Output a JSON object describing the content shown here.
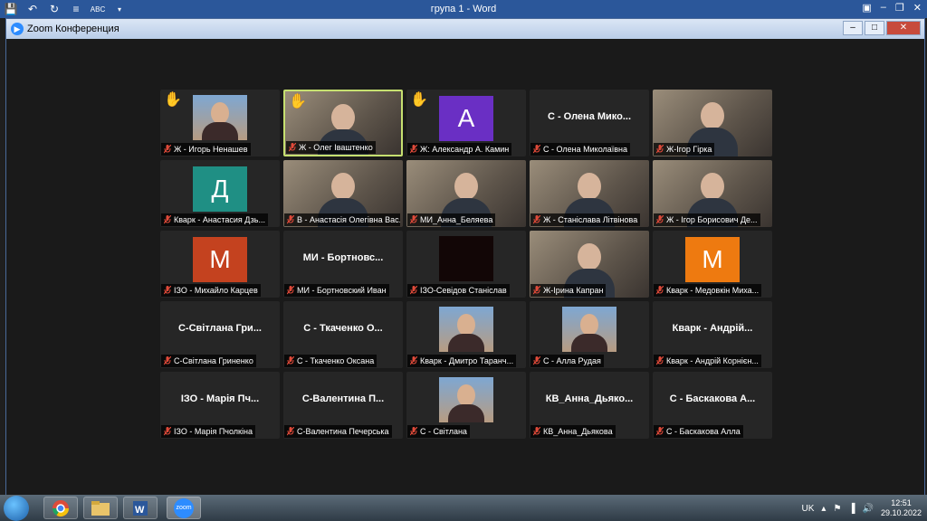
{
  "word_window": {
    "title": "група 1 - Word",
    "quick_access_icons": [
      "save-icon",
      "undo-icon",
      "redo-icon",
      "menu-icon",
      "spellcheck-icon",
      "dropdown-icon"
    ]
  },
  "zoom_window": {
    "title": "Zoom Конференция"
  },
  "participants": [
    {
      "caption": "Ж - Игорь Ненашев",
      "center_name": "",
      "hand": true,
      "avatar_letter": "",
      "avatar_color": "",
      "video": "photo"
    },
    {
      "caption": "Ж - Олег Іваштенко",
      "center_name": "",
      "hand": true,
      "avatar_letter": "",
      "avatar_color": "",
      "video": "camera",
      "active": true
    },
    {
      "caption": "Ж: Александр А. Камин",
      "center_name": "",
      "hand": true,
      "avatar_letter": "А",
      "avatar_color": "#6a2fc4",
      "video": ""
    },
    {
      "caption": "С - Олена Миколаївна",
      "center_name": "С - Олена Мико...",
      "hand": false,
      "avatar_letter": "",
      "avatar_color": "",
      "video": ""
    },
    {
      "caption": "Ж-Ігор Гірка",
      "center_name": "",
      "hand": false,
      "avatar_letter": "",
      "avatar_color": "",
      "video": "camera"
    },
    {
      "caption": "Кварк - Анастасия Дзь...",
      "center_name": "",
      "hand": false,
      "avatar_letter": "Д",
      "avatar_color": "#1f8f84",
      "video": ""
    },
    {
      "caption": "В - Анастасія Олегівна Вас...",
      "center_name": "",
      "hand": false,
      "avatar_letter": "",
      "avatar_color": "",
      "video": "camera"
    },
    {
      "caption": "МИ_Анна_Беляева",
      "center_name": "",
      "hand": false,
      "avatar_letter": "",
      "avatar_color": "",
      "video": "camera"
    },
    {
      "caption": "Ж - Станіслава Літвінова",
      "center_name": "",
      "hand": false,
      "avatar_letter": "",
      "avatar_color": "",
      "video": "camera"
    },
    {
      "caption": "Ж - Ігор Борисович Де...",
      "center_name": "",
      "hand": false,
      "avatar_letter": "",
      "avatar_color": "",
      "video": "camera"
    },
    {
      "caption": "ІЗО - Михайло Карцев",
      "center_name": "",
      "hand": false,
      "avatar_letter": "М",
      "avatar_color": "#c4421f",
      "video": ""
    },
    {
      "caption": "МИ - Бортновский Иван",
      "center_name": "МИ - Бортновс...",
      "hand": false,
      "avatar_letter": "",
      "avatar_color": "",
      "video": ""
    },
    {
      "caption": "ІЗО-Севідов Станіслав",
      "center_name": "",
      "hand": false,
      "avatar_letter": "",
      "avatar_color": "",
      "video": "dark"
    },
    {
      "caption": "Ж-Ірина Капран",
      "center_name": "",
      "hand": false,
      "avatar_letter": "",
      "avatar_color": "",
      "video": "camera"
    },
    {
      "caption": "Кварк - Медовкін Миха...",
      "center_name": "",
      "hand": false,
      "avatar_letter": "М",
      "avatar_color": "#ee7a10",
      "video": ""
    },
    {
      "caption": "С-Світлана Гриненко",
      "center_name": "С-Світлана Гри...",
      "hand": false,
      "avatar_letter": "",
      "avatar_color": "",
      "video": ""
    },
    {
      "caption": "С - Ткаченко Оксана",
      "center_name": "С - Ткаченко О...",
      "hand": false,
      "avatar_letter": "",
      "avatar_color": "",
      "video": ""
    },
    {
      "caption": "Кварк - Дмитро Таранч...",
      "center_name": "",
      "hand": false,
      "avatar_letter": "",
      "avatar_color": "",
      "video": "photo"
    },
    {
      "caption": "С - Алла Рудая",
      "center_name": "",
      "hand": false,
      "avatar_letter": "",
      "avatar_color": "",
      "video": "photo"
    },
    {
      "caption": "Кварк - Андрій Корнієн...",
      "center_name": "Кварк - Андрій...",
      "hand": false,
      "avatar_letter": "",
      "avatar_color": "",
      "video": ""
    },
    {
      "caption": "ІЗО - Марія Пчолкіна",
      "center_name": "ІЗО - Марія Пч...",
      "hand": false,
      "avatar_letter": "",
      "avatar_color": "",
      "video": ""
    },
    {
      "caption": "С-Валентина Печерська",
      "center_name": "С-Валентина П...",
      "hand": false,
      "avatar_letter": "",
      "avatar_color": "",
      "video": ""
    },
    {
      "caption": "С - Світлана",
      "center_name": "",
      "hand": false,
      "avatar_letter": "",
      "avatar_color": "",
      "video": "photo"
    },
    {
      "caption": "КВ_Анна_Дьякова",
      "center_name": "КВ_Анна_Дьяко...",
      "hand": false,
      "avatar_letter": "",
      "avatar_color": "",
      "video": ""
    },
    {
      "caption": "С - Баскакова Алла",
      "center_name": "С - Баскакова А...",
      "hand": false,
      "avatar_letter": "",
      "avatar_color": "",
      "video": ""
    }
  ],
  "taskbar": {
    "apps": [
      "chrome-icon",
      "explorer-icon",
      "word-icon",
      "zoom-icon"
    ],
    "zoom_app_label": "zoom",
    "language": "UK",
    "time": "12:51",
    "date": "29.10.2022"
  }
}
